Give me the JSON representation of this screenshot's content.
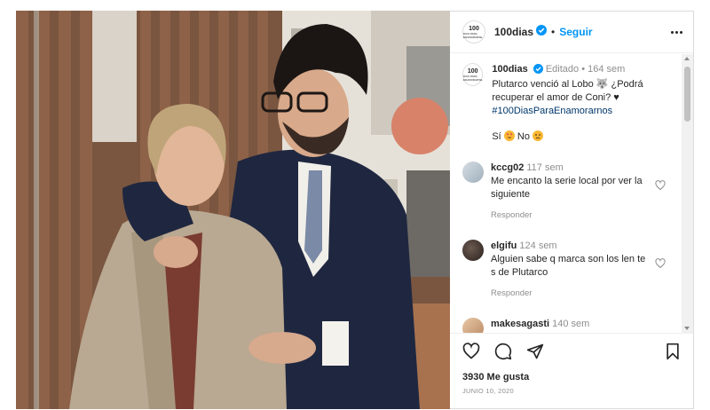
{
  "post": {
    "username": "100dias",
    "logo_text": "100",
    "logo_subtext": "DIAS PARA ENAMORARSE",
    "follow_label": "Seguir",
    "separator": "•"
  },
  "caption": {
    "username": "100dias",
    "edited": "Editado",
    "time": "164 sem",
    "text": "Plutarco venció al Lobo 🐺 ¿Podrá recuperar el amor de Coni? ♥",
    "hashtag": "#100DiasParaEnamorarnos",
    "poll_yes": "Sí",
    "poll_no": "No"
  },
  "comments": [
    {
      "username": "kccg02",
      "time": "117 sem",
      "text": "Me encanto la serie local por ver la siguiente",
      "reply_label": "Responder"
    },
    {
      "username": "elgifu",
      "time": "124 sem",
      "text": "Alguien sabe q marca son los len te s de Plutarco",
      "reply_label": "Responder"
    },
    {
      "username": "makesagasti",
      "time": "140 sem"
    }
  ],
  "footer": {
    "likes": "3930 Me gusta",
    "date": "JUNIO 10, 2020"
  },
  "icons": [
    "verified-icon",
    "more-icon",
    "heart-icon",
    "comment-icon",
    "share-icon",
    "save-icon",
    "wolf-emoji",
    "heart-eyes-emoji",
    "sad-emoji"
  ],
  "colors": {
    "accent": "#0095f6",
    "hashtag": "#00376b",
    "muted": "#8e8e8e"
  }
}
